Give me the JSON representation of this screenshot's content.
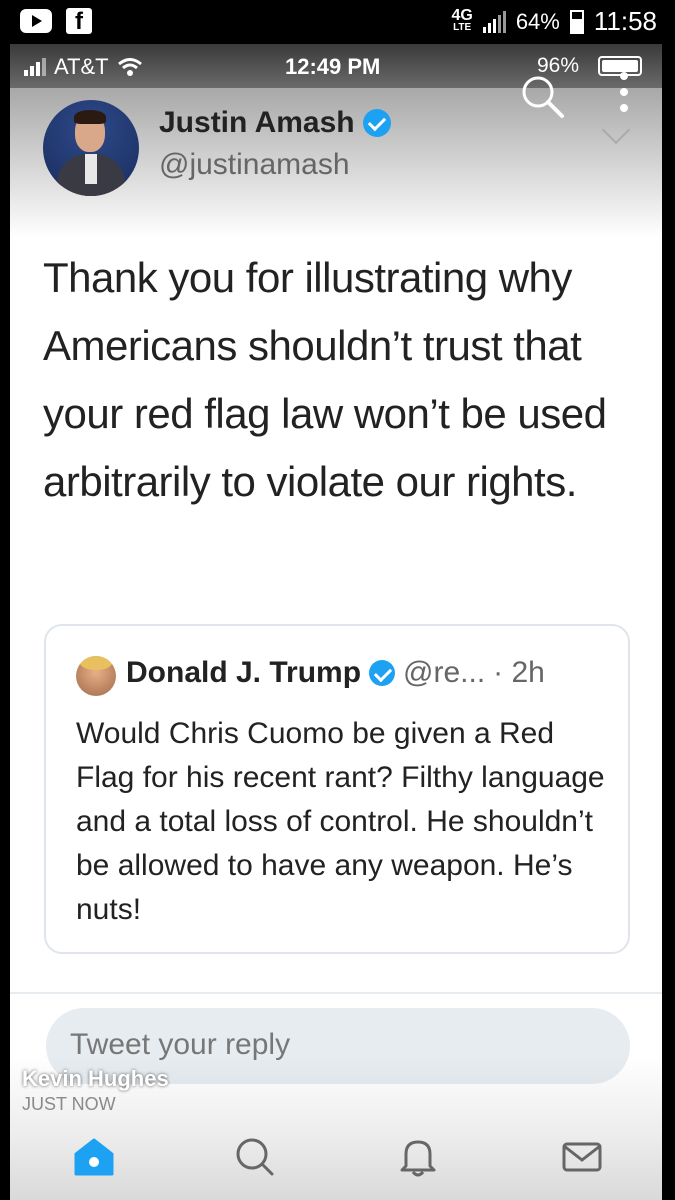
{
  "outer_status": {
    "network": "4G",
    "network_sub": "LTE",
    "battery_pct": "64%",
    "time": "11:58"
  },
  "inner_status": {
    "carrier": "AT&T",
    "time": "12:49 PM",
    "battery_pct": "96%"
  },
  "tweet": {
    "author_name": "Justin Amash",
    "author_handle": "@justinamash",
    "text": "Thank you for illustrating why Americans shouldn’t trust that your red flag law won’t be used arbitrarily to violate our rights."
  },
  "quoted_tweet": {
    "author_name": "Donald J. Trump",
    "author_handle": "@re...",
    "age": "· 2h",
    "text": "Would Chris Cuomo be given a Red Flag for his recent rant? Filthy language and a total loss of control. He shouldn’t be allowed to have any weapon. He’s nuts!"
  },
  "reply": {
    "placeholder": "Tweet your reply"
  },
  "overlay": {
    "name": "Kevin Hughes",
    "time": "JUST NOW"
  },
  "tabs": [
    {
      "name": "home",
      "icon": "home-icon"
    },
    {
      "name": "search",
      "icon": "search-icon"
    },
    {
      "name": "notifications",
      "icon": "bell-icon"
    },
    {
      "name": "messages",
      "icon": "mail-icon"
    }
  ],
  "colors": {
    "accent": "#1da1f2",
    "text": "#222222",
    "secondary_text": "#666666",
    "reply_bg": "#e6ecf0"
  }
}
